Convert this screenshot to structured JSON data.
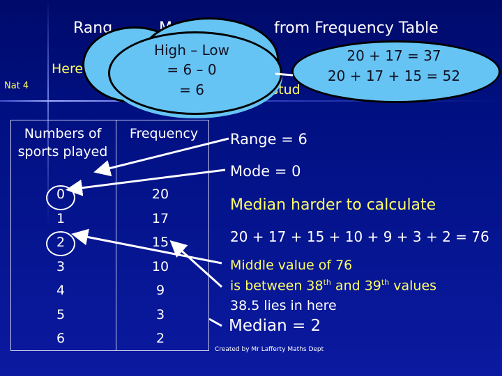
{
  "title_fragments": [
    "Rang",
    "M",
    "from Frequency Table"
  ],
  "subtitle_fragments": [
    "Here",
    "y stud"
  ],
  "level": "Nat 4",
  "table": {
    "headers": [
      "Numbers of sports played",
      "Frequency"
    ],
    "rows": [
      [
        "0",
        "20"
      ],
      [
        "1",
        "17"
      ],
      [
        "2",
        "15"
      ],
      [
        "3",
        "10"
      ],
      [
        "4",
        "9"
      ],
      [
        "5",
        "3"
      ],
      [
        "6",
        "2"
      ]
    ]
  },
  "cloud_range": [
    "High – Low",
    "= 6 – 0",
    "= 6"
  ],
  "cloud_median": [
    "20 + 17 = 37",
    "20 + 17 + 15 = 52"
  ],
  "range_text": "Range =  6",
  "mode_text": "Mode =  0",
  "median_harder": "Median harder to calculate",
  "sum_text": "20 + 17 + 15 + 10 + 9 + 3 + 2 = 76",
  "middle_line1": "Middle value of 76",
  "middle_line2_a": "is between 38",
  "middle_line2_sup1": "th",
  "middle_line2_b": " and 39",
  "middle_line2_sup2": "th",
  "middle_line2_c": " values",
  "middle_line3": "38.5 lies in here",
  "median_result": "Median = 2",
  "credit": "Created by Mr Lafferty Maths Dept",
  "colors": {
    "background": "#001080",
    "highlight": "#ffff66",
    "cloud": "#66c4f4"
  }
}
